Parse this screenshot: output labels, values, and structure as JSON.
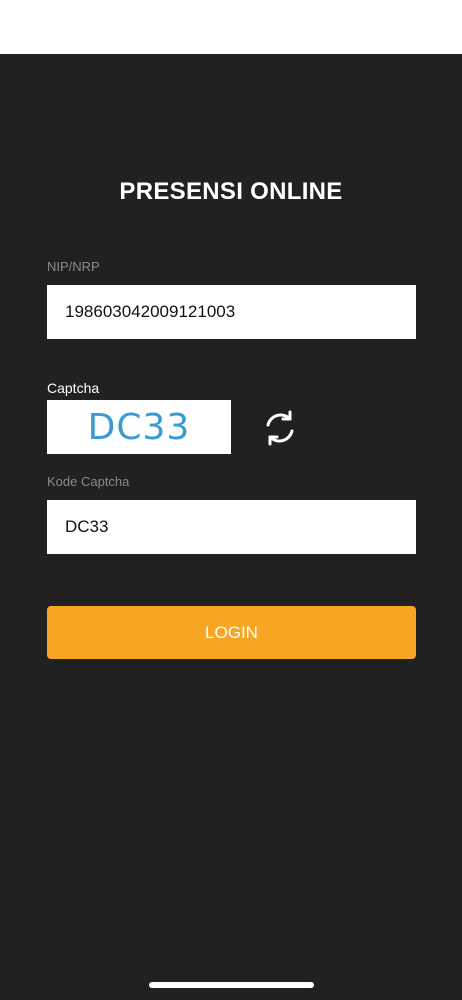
{
  "page": {
    "title": "PRESENSI ONLINE"
  },
  "nip": {
    "label": "NIP/NRP",
    "value": "198603042009121003"
  },
  "captcha": {
    "label": "Captcha",
    "image_text": "DC33",
    "refresh_icon": "refresh-icon"
  },
  "kode_captcha": {
    "label": "Kode Captcha",
    "value": "DC33"
  },
  "login": {
    "label": "LOGIN"
  },
  "colors": {
    "background": "#222122",
    "accent": "#f6a623",
    "captcha_text": "#3a9bd4"
  }
}
